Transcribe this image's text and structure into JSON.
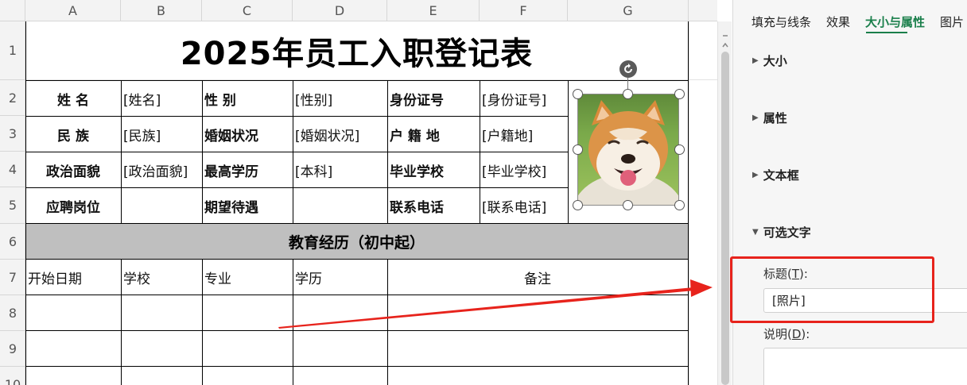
{
  "columns": [
    "A",
    "B",
    "C",
    "D",
    "E",
    "F",
    "G"
  ],
  "rows": [
    "1",
    "2",
    "3",
    "4",
    "5",
    "6",
    "7",
    "8",
    "9",
    "10"
  ],
  "sheet": {
    "title": "2025年员工入职登记表",
    "form": [
      {
        "l1": "姓 名",
        "v1": "[姓名]",
        "l2": "性 别",
        "v2": "[性别]",
        "l3": "身份证号",
        "v3": "[身份证号]"
      },
      {
        "l1": "民 族",
        "v1": "[民族]",
        "l2": "婚姻状况",
        "v2": "[婚姻状况]",
        "l3": "户 籍 地",
        "v3": "[户籍地]"
      },
      {
        "l1": "政治面貌",
        "v1": "[政治面貌]",
        "l2": "最高学历",
        "v2": "[本科]",
        "l3": "毕业学校",
        "v3": "[毕业学校]"
      },
      {
        "l1": "应聘岗位",
        "v1": "",
        "l2": "期望待遇",
        "v2": "",
        "l3": "联系电话",
        "v3": "[联系电话]"
      }
    ],
    "education_header": "教育经历（初中起）",
    "education_cols": [
      "开始日期",
      "学校",
      "专业",
      "学历",
      "备注"
    ]
  },
  "panel": {
    "tabs": [
      "填充与线条",
      "效果",
      "大小与属性",
      "图片"
    ],
    "active_tab": "大小与属性",
    "sections": [
      "大小",
      "属性",
      "文本框",
      "可选文字"
    ],
    "title_label": "标题(",
    "title_key": "T",
    "title_suffix": "):",
    "title_value": "[照片]",
    "desc_label": "说明(",
    "desc_key": "D",
    "desc_suffix": "):"
  },
  "colors": {
    "accent": "#1a7f4b",
    "highlight_box": "#e7231c",
    "band": "#bfbfbf"
  },
  "icons": [
    "rotate-icon",
    "collapse-triangle-icon",
    "expand-triangle-icon",
    "scroll-up-icon"
  ]
}
